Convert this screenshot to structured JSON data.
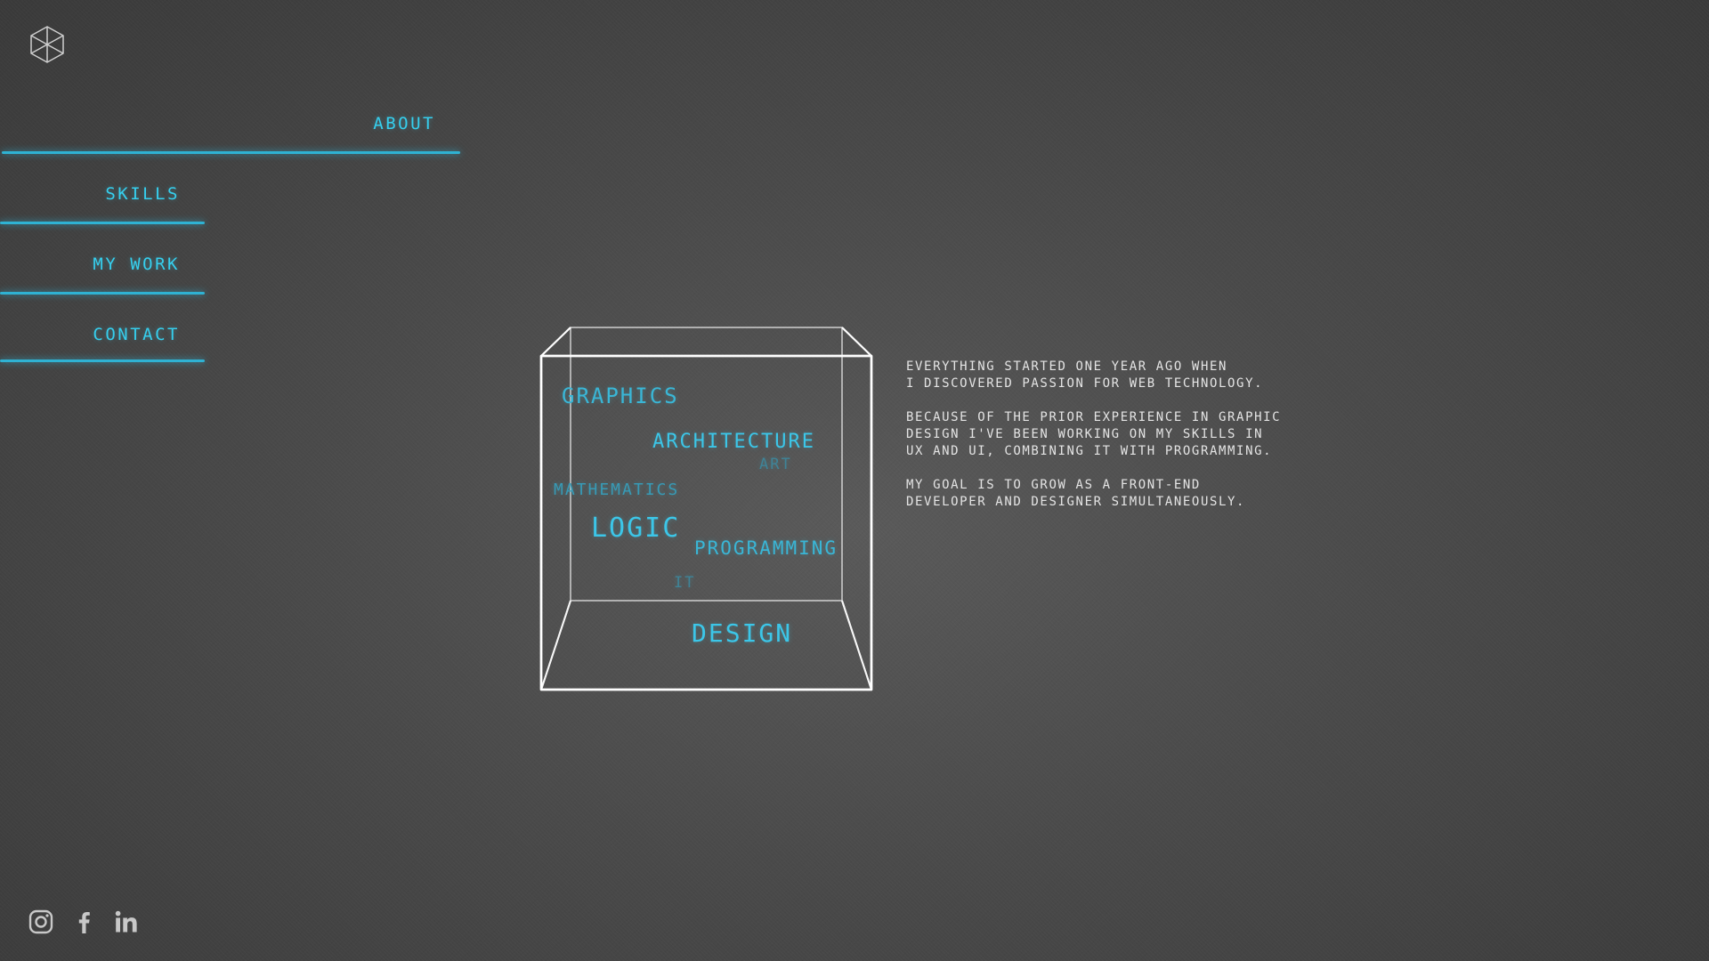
{
  "colors": {
    "accent": "#36cfee",
    "accent_line": "#2fb2d3",
    "text": "#e4e4e4",
    "cube_stroke": "#ffffff"
  },
  "logo": {
    "icon": "hexagon-cube-logo-icon"
  },
  "nav": {
    "items": [
      {
        "label": "ABOUT",
        "active": true
      },
      {
        "label": "SKILLS",
        "active": false
      },
      {
        "label": "MY WORK",
        "active": false
      },
      {
        "label": "CONTACT",
        "active": false
      }
    ]
  },
  "cube_words": {
    "graphics": "GRAPHICS",
    "architecture": "ARCHITECTURE",
    "art": "ART",
    "mathematics": "MATHEMATICS",
    "logic": "LOGIC",
    "programming": "PROGRAMMING",
    "it": "IT",
    "design": "DESIGN"
  },
  "about": {
    "paragraphs": [
      "EVERYTHING STARTED ONE YEAR AGO WHEN\nI DISCOVERED PASSION FOR WEB TECHNOLOGY.",
      "BECAUSE OF THE PRIOR EXPERIENCE IN GRAPHIC\nDESIGN I'VE BEEN WORKING ON MY SKILLS IN\nUX AND UI, COMBINING IT WITH PROGRAMMING.",
      "MY GOAL IS TO GROW AS A FRONT-END\nDEVELOPER AND DESIGNER SIMULTANEOUSLY."
    ]
  },
  "social": {
    "icons": [
      "instagram-icon",
      "facebook-icon",
      "linkedin-icon"
    ]
  }
}
